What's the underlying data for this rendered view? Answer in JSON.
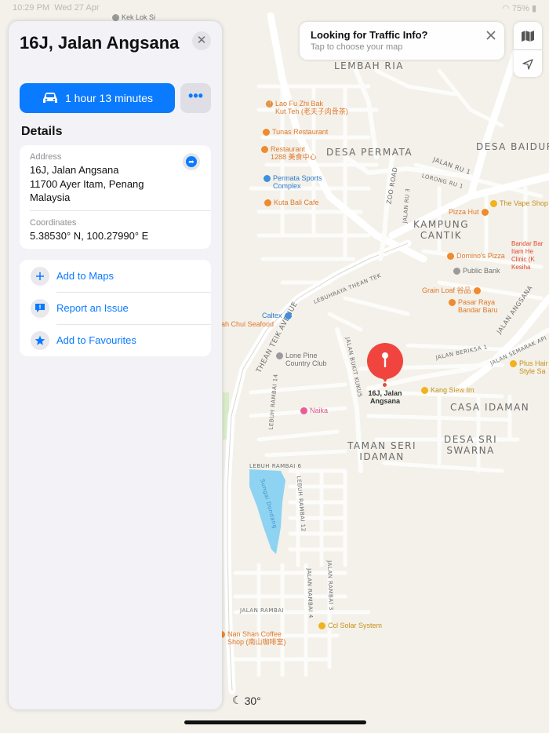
{
  "status_bar": {
    "time": "10:29 PM",
    "date": "Wed 27 Apr",
    "battery": "75%"
  },
  "place": {
    "title": "16J, Jalan Angsana",
    "close_symbol": "✕"
  },
  "directions": {
    "label": "1 hour 13 minutes",
    "more_symbol": "•••"
  },
  "details": {
    "heading": "Details",
    "address_label": "Address",
    "address_value": "16J, Jalan Angsana\n11700 Ayer Itam, Penang\nMalaysia",
    "coordinates_label": "Coordinates",
    "coordinates_value": "5.38530° N, 100.27990° E"
  },
  "actions": [
    {
      "label": "Add to Maps",
      "icon": "plus-icon"
    },
    {
      "label": "Report an Issue",
      "icon": "report-icon"
    },
    {
      "label": "Add to Favourites",
      "icon": "star-icon"
    }
  ],
  "traffic": {
    "title": "Looking for Traffic Info?",
    "subtitle": "Tap to choose your map"
  },
  "weather": {
    "temperature": "30°"
  },
  "pin": {
    "label": "16J, Jalan\nAngsana"
  },
  "map": {
    "areas": [
      {
        "name": "LEMBAH RIA"
      },
      {
        "name": "DESA PERMATA"
      },
      {
        "name": "DESA BAIDURI"
      },
      {
        "name": "KAMPUNG\nCANTIK"
      },
      {
        "name": "CASA IDAMAN"
      },
      {
        "name": "DESA SRI\nSWARNA"
      },
      {
        "name": "TAMAN SERI\nIDAMAN"
      }
    ],
    "roads": [
      {
        "name": "JALAN RU 1"
      },
      {
        "name": "LORONG RU 1"
      },
      {
        "name": "ZOO ROAD"
      },
      {
        "name": "JALAN RU 3"
      },
      {
        "name": "LEBUHRAYA THEAN TEK"
      },
      {
        "name": "THEAN TEIK AVENUE"
      },
      {
        "name": "JALAN BUKIT KUKUS"
      },
      {
        "name": "JALAN BERIKSA 1"
      },
      {
        "name": "JALAN ANGSANA"
      },
      {
        "name": "JALAN SEMARAK API"
      },
      {
        "name": "LEBUH RAMBAI 14"
      },
      {
        "name": "LEBUH RAMBAI 6"
      },
      {
        "name": "LEBUH RAMBAI 12"
      },
      {
        "name": "JALAN RAMBAI 4"
      },
      {
        "name": "JALAN RAMBAI 3"
      },
      {
        "name": "JALAN RAMBAI"
      },
      {
        "name": "Sungai Dondang"
      }
    ],
    "pois": [
      {
        "name": "Kek Lok Si",
        "color": "gray"
      },
      {
        "name": "Lao Fu Zhi Bak\nKut Teh (老夫子肉骨茶)",
        "color": "orange"
      },
      {
        "name": "Tunas Restaurant",
        "color": "orange"
      },
      {
        "name": "Restaurant\n1288 美食中心",
        "color": "orange"
      },
      {
        "name": "Permata Sports\nComplex",
        "color": "blue"
      },
      {
        "name": "Kuta Bali Cafe",
        "color": "orange"
      },
      {
        "name": "Pizza Hut",
        "color": "orange"
      },
      {
        "name": "The Vape Shop",
        "color": "yellow"
      },
      {
        "name": "Domino's Pizza",
        "color": "orange"
      },
      {
        "name": "Public Bank",
        "color": "gray"
      },
      {
        "name": "Grain Loaf 谷品",
        "color": "orange"
      },
      {
        "name": "Pasar Raya\nBandar Baru",
        "color": "orange"
      },
      {
        "name": "Caltex",
        "color": "blue"
      },
      {
        "name": "Lone Pine\nCountry Club",
        "color": "gray"
      },
      {
        "name": "Kang Siew Im",
        "color": "yellow"
      },
      {
        "name": "Naika",
        "color": "pink"
      },
      {
        "name": "Plus Hair\nStyle Sa",
        "color": "yellow"
      },
      {
        "name": "Bandar Bar\nItam He\nClinic (K\nKesiha",
        "color": "red"
      },
      {
        "name": "Nan Shan Coffee\nShop (南山咖啡室)",
        "color": "orange"
      },
      {
        "name": "Ccl Solar System",
        "color": "yellow"
      },
      {
        "name": "ah Chui Seafood",
        "color": "orange"
      }
    ]
  }
}
